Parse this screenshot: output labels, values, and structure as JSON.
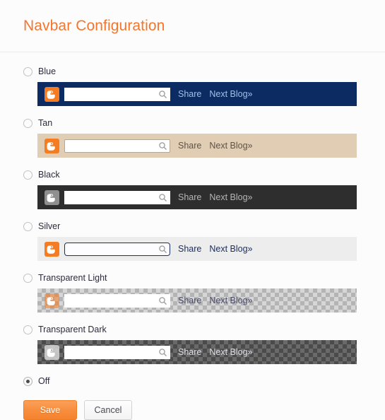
{
  "header": {
    "title": "Navbar Configuration",
    "title_color": "#f2762e"
  },
  "navbar": {
    "search_placeholder": "",
    "search_icon": "magnifier-icon",
    "brand_icon": "blogger-b-icon",
    "share_label": "Share",
    "next_blog_label": "Next Blog»"
  },
  "options": [
    {
      "id": "blue",
      "label": "Blue",
      "selected": false,
      "has_preview": true,
      "bg_color": "#0d2b63",
      "link_color": "#9fc0e8",
      "brand_color": "#f57c20"
    },
    {
      "id": "tan",
      "label": "Tan",
      "selected": false,
      "has_preview": true,
      "bg_color": "#e0cdb4",
      "link_color": "#5d5347",
      "brand_color": "#f57c20"
    },
    {
      "id": "black",
      "label": "Black",
      "selected": false,
      "has_preview": true,
      "bg_color": "#2e2e2e",
      "link_color": "#b6b6b6",
      "brand_color": "#8f8f8f"
    },
    {
      "id": "silver",
      "label": "Silver",
      "selected": false,
      "has_preview": true,
      "bg_color": "#ededed",
      "link_color": "#1c2f63",
      "brand_color": "#f57c20"
    },
    {
      "id": "transparent-light",
      "label": "Transparent Light",
      "selected": false,
      "has_preview": true,
      "bg_color": "#d6d6d6",
      "link_color": "#4b4b6a",
      "brand_color": "#f57c20"
    },
    {
      "id": "transparent-dark",
      "label": "Transparent Dark",
      "selected": false,
      "has_preview": true,
      "bg_color": "#6a6a6a",
      "link_color": "#dcdce6",
      "brand_color": "#d7d7d7"
    },
    {
      "id": "off",
      "label": "Off",
      "selected": true,
      "has_preview": false
    }
  ],
  "actions": {
    "save_label": "Save",
    "cancel_label": "Cancel",
    "save_color": "#f5822d"
  }
}
